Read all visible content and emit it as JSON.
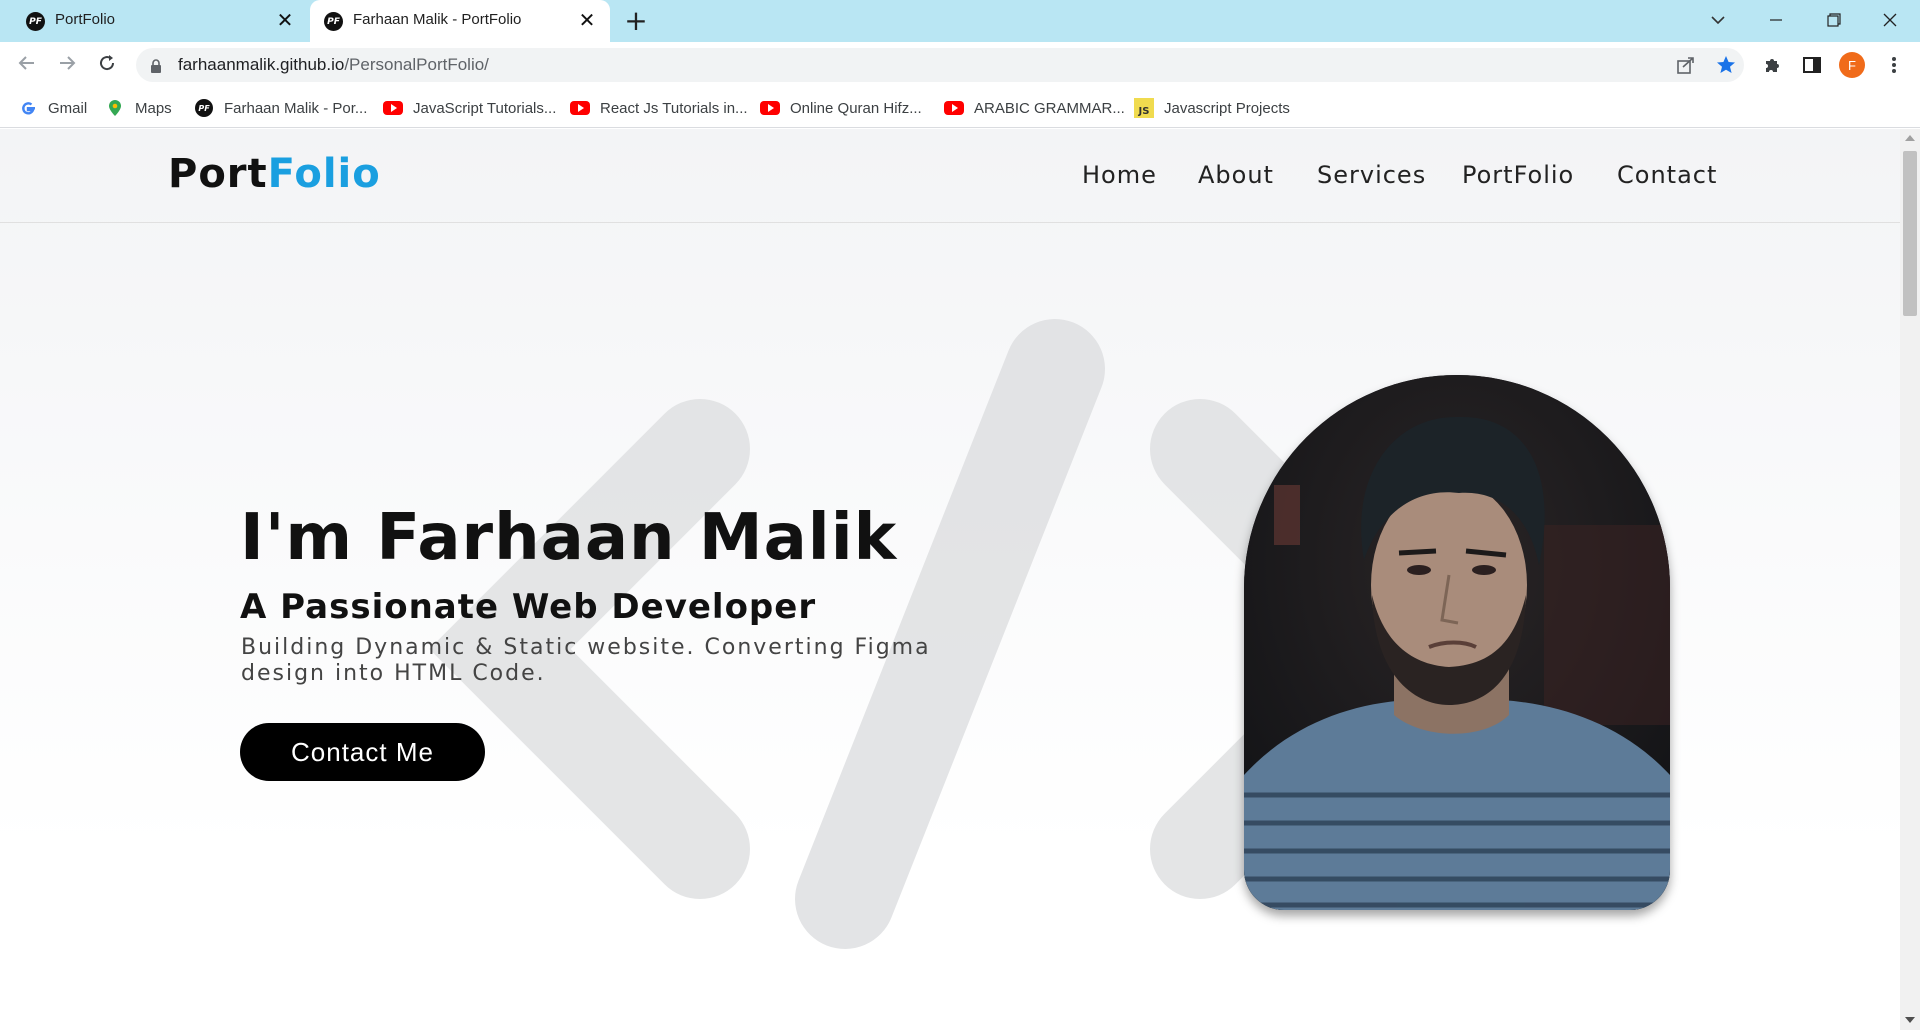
{
  "browser": {
    "tabs": [
      {
        "title": "PortFolio",
        "favicon": "PF"
      },
      {
        "title": "Farhaan Malik - PortFolio",
        "favicon": "PF"
      }
    ],
    "url_host": "farhaanmalik.github.io",
    "url_path": "/PersonalPortFolio/",
    "profile_initial": "F",
    "bookmarks": [
      {
        "label": "Gmail",
        "icon": "google-icon"
      },
      {
        "label": "Maps",
        "icon": "maps-pin-icon"
      },
      {
        "label": "Farhaan Malik - Por...",
        "icon": "pf-favicon-icon"
      },
      {
        "label": "JavaScript Tutorials...",
        "icon": "youtube-icon"
      },
      {
        "label": "React Js Tutorials in...",
        "icon": "youtube-icon"
      },
      {
        "label": "Online Quran Hifz...",
        "icon": "youtube-icon"
      },
      {
        "label": "ARABIC GRAMMAR...",
        "icon": "youtube-icon"
      },
      {
        "label": "Javascript Projects",
        "icon": "js-icon"
      }
    ],
    "js_badge": "JS"
  },
  "site": {
    "logo_part1": "Port",
    "logo_part2": "Folio",
    "logo_accent_color": "#1a9fe0",
    "nav": [
      "Home",
      "About",
      "Services",
      "PortFolio",
      "Contact"
    ],
    "hero": {
      "title": "I'm Farhaan Malik",
      "subtitle": "A Passionate Web Developer",
      "description": "Building Dynamic & Static website. Converting Figma design into HTML Code.",
      "button": "Contact Me"
    }
  }
}
